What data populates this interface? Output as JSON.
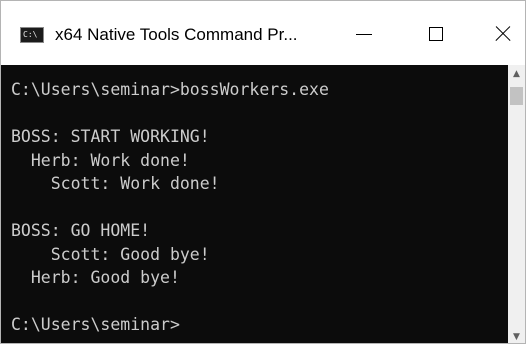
{
  "window": {
    "title": "x64 Native Tools Command Pr..."
  },
  "titlebar": {
    "app_icon_text": "C:\\"
  },
  "console": {
    "lines": [
      "C:\\Users\\seminar>bossWorkers.exe",
      "",
      "BOSS: START WORKING!",
      "  Herb: Work done!",
      "    Scott: Work done!",
      "",
      "BOSS: GO HOME!",
      "    Scott: Good bye!",
      "  Herb: Good bye!",
      "",
      "C:\\Users\\seminar>"
    ]
  },
  "colors": {
    "console_background": "#0c0c0c",
    "console_text": "#cccccc",
    "titlebar_background": "#ffffff"
  },
  "icons": {
    "app": "command-prompt-icon",
    "minimize": "minimize-icon",
    "maximize": "maximize-icon",
    "close": "close-icon",
    "scroll_up": "chevron-up-icon",
    "scroll_down": "chevron-down-icon"
  }
}
